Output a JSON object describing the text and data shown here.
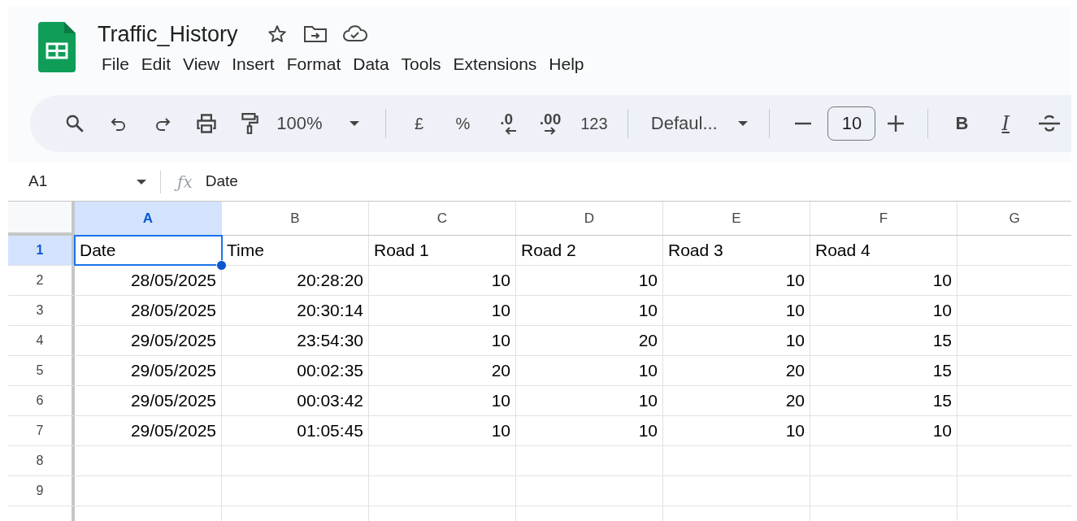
{
  "document": {
    "title": "Traffic_History"
  },
  "menu": [
    "File",
    "Edit",
    "View",
    "Insert",
    "Format",
    "Data",
    "Tools",
    "Extensions",
    "Help"
  ],
  "toolbar": [
    {
      "kind": "search"
    },
    {
      "kind": "undo"
    },
    {
      "kind": "redo"
    },
    {
      "kind": "print"
    },
    {
      "kind": "paint-format"
    },
    {
      "kind": "zoom",
      "label": "100%"
    },
    {
      "kind": "separator"
    },
    {
      "kind": "text",
      "label": "£"
    },
    {
      "kind": "text",
      "label": "%"
    },
    {
      "kind": "decimal-decrease",
      "label": ".0"
    },
    {
      "kind": "decimal-increase",
      "label": ".00"
    },
    {
      "kind": "text",
      "label": "123"
    },
    {
      "kind": "separator"
    },
    {
      "kind": "font",
      "label": "Defaul..."
    },
    {
      "kind": "separator"
    },
    {
      "kind": "minus"
    },
    {
      "kind": "size",
      "value": "10"
    },
    {
      "kind": "plus"
    },
    {
      "kind": "separator"
    },
    {
      "kind": "bold",
      "label": "B"
    },
    {
      "kind": "italic",
      "label": "I"
    },
    {
      "kind": "strikethrough"
    }
  ],
  "formula_bar": {
    "cell_reference": "A1",
    "function_icon": "ƒx",
    "value": "Date"
  },
  "columns": [
    {
      "label": "A",
      "selected": true
    },
    {
      "label": "B",
      "selected": false
    },
    {
      "label": "C",
      "selected": false
    },
    {
      "label": "D",
      "selected": false
    },
    {
      "label": "E",
      "selected": false
    },
    {
      "label": "F",
      "selected": false
    },
    {
      "label": "G",
      "selected": false
    }
  ],
  "rows": [
    {
      "number": "1",
      "selected": true,
      "kind": "header",
      "cells": [
        "Date",
        "Time",
        "Road 1",
        "Road 2",
        "Road 3",
        "Road 4"
      ]
    },
    {
      "number": "2",
      "selected": false,
      "kind": "data",
      "cells": [
        "28/05/2025",
        "20:28:20",
        "10",
        "10",
        "10",
        "10"
      ]
    },
    {
      "number": "3",
      "selected": false,
      "kind": "data",
      "cells": [
        "28/05/2025",
        "20:30:14",
        "10",
        "10",
        "10",
        "10"
      ]
    },
    {
      "number": "4",
      "selected": false,
      "kind": "data",
      "cells": [
        "29/05/2025",
        "23:54:30",
        "10",
        "20",
        "10",
        "15"
      ]
    },
    {
      "number": "5",
      "selected": false,
      "kind": "data",
      "cells": [
        "29/05/2025",
        "00:02:35",
        "20",
        "10",
        "20",
        "15"
      ]
    },
    {
      "number": "6",
      "selected": false,
      "kind": "data",
      "cells": [
        "29/05/2025",
        "00:03:42",
        "10",
        "10",
        "20",
        "15"
      ]
    },
    {
      "number": "7",
      "selected": false,
      "kind": "data",
      "cells": [
        "29/05/2025",
        "01:05:45",
        "10",
        "10",
        "10",
        "10"
      ]
    },
    {
      "number": "8",
      "selected": false,
      "cells": []
    },
    {
      "number": "9",
      "selected": false,
      "cells": []
    }
  ]
}
